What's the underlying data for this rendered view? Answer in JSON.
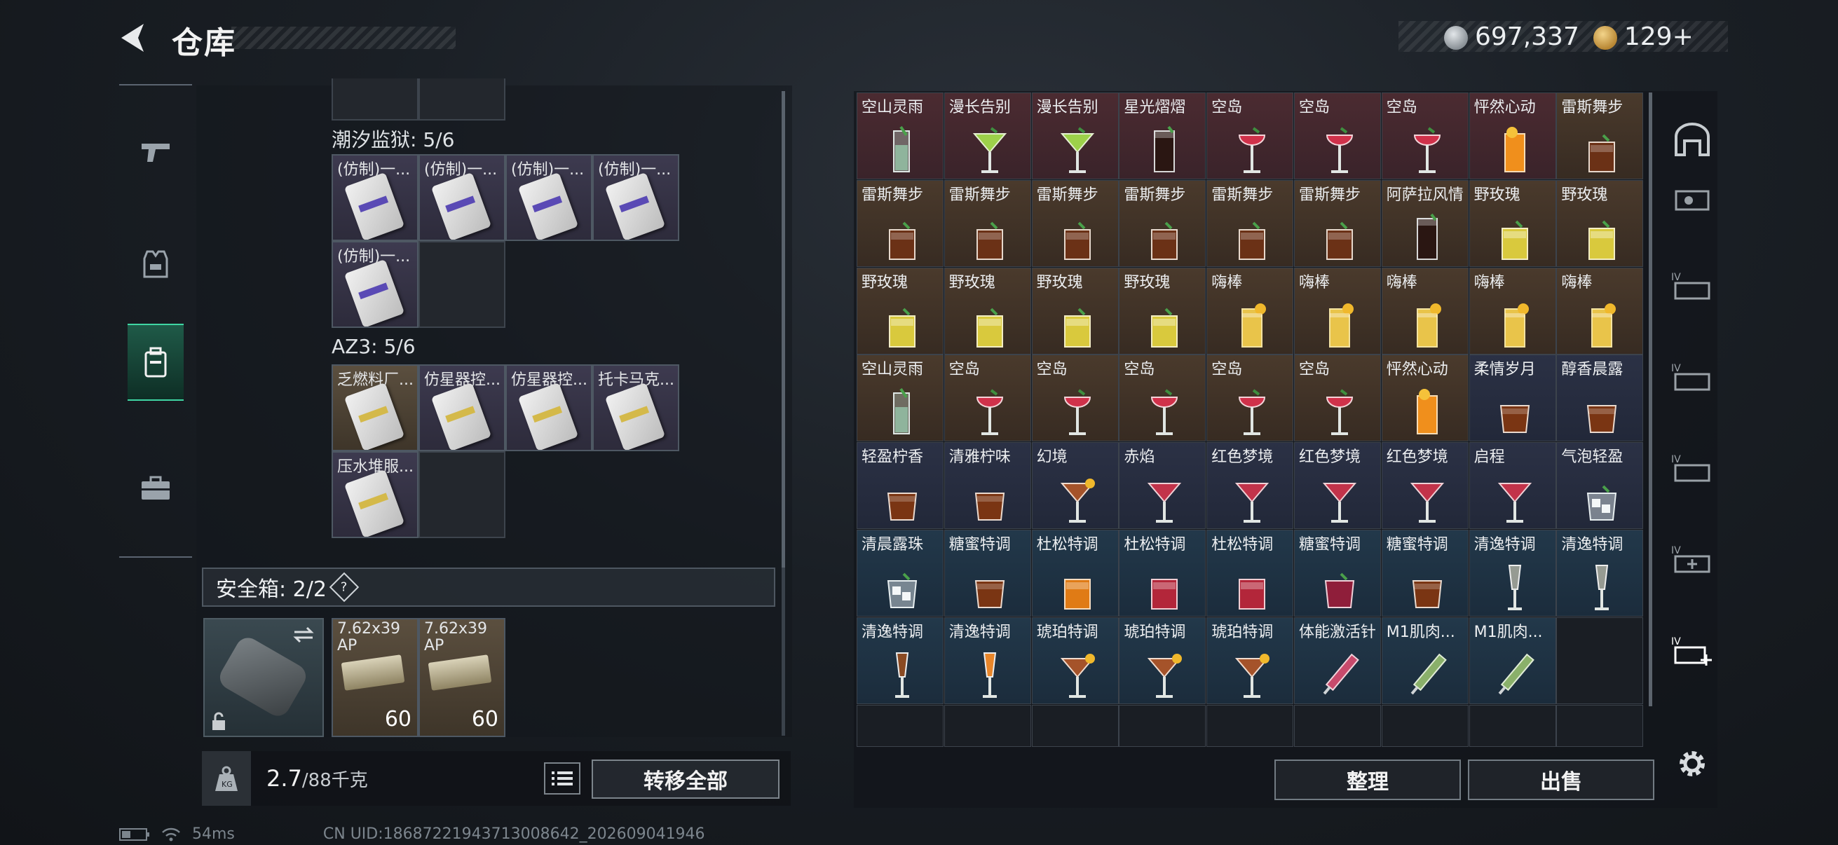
{
  "header": {
    "title": "仓库"
  },
  "currency": {
    "silver": "697,337",
    "gold": "129+"
  },
  "left": {
    "partial_row_label": "",
    "section1": {
      "label": "潮汐监狱: 5/6",
      "items": [
        "(仿制)一...",
        "(仿制)一...",
        "(仿制)一...",
        "(仿制)一...",
        "(仿制)一..."
      ]
    },
    "section2": {
      "label": "AZ3: 5/6",
      "items": [
        "乏燃料厂...",
        "仿星器控...",
        "仿星器控...",
        "托卡马克...",
        "压水堆服..."
      ]
    },
    "safe": {
      "label": "安全箱: 2/2",
      "help": "?"
    },
    "ammo": [
      {
        "name": "7.62x39 AP",
        "count": "60"
      },
      {
        "name": "7.62x39 AP",
        "count": "60"
      }
    ],
    "weight": {
      "value": "2.7",
      "cap": "/88千克"
    },
    "transfer_all": "转移全部"
  },
  "grid": {
    "rows": [
      [
        {
          "n": "空山灵雨",
          "bg": "red",
          "d": "highball"
        },
        {
          "n": "漫长告别",
          "bg": "red",
          "d": "martini-green"
        },
        {
          "n": "漫长告别",
          "bg": "red",
          "d": "martini-green"
        },
        {
          "n": "星光熠熠",
          "bg": "red",
          "d": "cola"
        },
        {
          "n": "空岛",
          "bg": "red",
          "d": "coupe-red"
        },
        {
          "n": "空岛",
          "bg": "red",
          "d": "coupe-red"
        },
        {
          "n": "空岛",
          "bg": "red",
          "d": "coupe-red"
        },
        {
          "n": "怦然心动",
          "bg": "red",
          "d": "orange-tall"
        },
        {
          "n": "雷斯舞步",
          "bg": "brown",
          "d": "rocks-brown"
        }
      ],
      [
        {
          "n": "雷斯舞步",
          "bg": "brown",
          "d": "rocks-brown"
        },
        {
          "n": "雷斯舞步",
          "bg": "brown",
          "d": "rocks-brown"
        },
        {
          "n": "雷斯舞步",
          "bg": "brown",
          "d": "rocks-brown"
        },
        {
          "n": "雷斯舞步",
          "bg": "brown",
          "d": "rocks-brown"
        },
        {
          "n": "雷斯舞步",
          "bg": "brown",
          "d": "rocks-brown"
        },
        {
          "n": "雷斯舞步",
          "bg": "brown",
          "d": "rocks-brown"
        },
        {
          "n": "阿萨拉风情",
          "bg": "brown",
          "d": "cola"
        },
        {
          "n": "野玫瑰",
          "bg": "brown",
          "d": "rocks-yellow"
        },
        {
          "n": "野玫瑰",
          "bg": "brown",
          "d": "rocks-yellow"
        }
      ],
      [
        {
          "n": "野玫瑰",
          "bg": "brown",
          "d": "rocks-yellow"
        },
        {
          "n": "野玫瑰",
          "bg": "brown",
          "d": "rocks-yellow"
        },
        {
          "n": "野玫瑰",
          "bg": "brown",
          "d": "rocks-yellow"
        },
        {
          "n": "野玫瑰",
          "bg": "brown",
          "d": "rocks-yellow"
        },
        {
          "n": "嗨棒",
          "bg": "brown",
          "d": "highball-yellow"
        },
        {
          "n": "嗨棒",
          "bg": "brown",
          "d": "highball-yellow"
        },
        {
          "n": "嗨棒",
          "bg": "brown",
          "d": "highball-yellow"
        },
        {
          "n": "嗨棒",
          "bg": "brown",
          "d": "highball-yellow"
        },
        {
          "n": "嗨棒",
          "bg": "brown",
          "d": "highball-yellow"
        }
      ],
      [
        {
          "n": "空山灵雨",
          "bg": "brown",
          "d": "highball"
        },
        {
          "n": "空岛",
          "bg": "brown",
          "d": "coupe-red"
        },
        {
          "n": "空岛",
          "bg": "brown",
          "d": "coupe-red"
        },
        {
          "n": "空岛",
          "bg": "brown",
          "d": "coupe-red"
        },
        {
          "n": "空岛",
          "bg": "brown",
          "d": "coupe-red"
        },
        {
          "n": "空岛",
          "bg": "brown",
          "d": "coupe-red"
        },
        {
          "n": "怦然心动",
          "bg": "brown",
          "d": "orange-tall"
        },
        {
          "n": "柔情岁月",
          "bg": "navy",
          "d": "round-brown"
        },
        {
          "n": "醇香晨露",
          "bg": "navy",
          "d": "round-brown"
        }
      ],
      [
        {
          "n": "轻盈柠香",
          "bg": "navy",
          "d": "round-brown"
        },
        {
          "n": "清雅柠味",
          "bg": "navy",
          "d": "round-brown"
        },
        {
          "n": "幻境",
          "bg": "navy",
          "d": "martini-brown"
        },
        {
          "n": "赤焰",
          "bg": "navy",
          "d": "martini-red"
        },
        {
          "n": "红色梦境",
          "bg": "navy",
          "d": "martini-red"
        },
        {
          "n": "红色梦境",
          "bg": "navy",
          "d": "martini-red"
        },
        {
          "n": "红色梦境",
          "bg": "navy",
          "d": "martini-red"
        },
        {
          "n": "启程",
          "bg": "navy",
          "d": "martini-red"
        },
        {
          "n": "气泡轻盈",
          "bg": "navy",
          "d": "ice"
        }
      ],
      [
        {
          "n": "清晨露珠",
          "bg": "teal",
          "d": "ice"
        },
        {
          "n": "糖蜜特调",
          "bg": "teal",
          "d": "round-brown"
        },
        {
          "n": "杜松特调",
          "bg": "teal",
          "d": "rocks-orange"
        },
        {
          "n": "杜松特调",
          "bg": "teal",
          "d": "rocks-red"
        },
        {
          "n": "杜松特调",
          "bg": "teal",
          "d": "rocks-red"
        },
        {
          "n": "糖蜜特调",
          "bg": "teal",
          "d": "round-red"
        },
        {
          "n": "糖蜜特调",
          "bg": "teal",
          "d": "round-brown"
        },
        {
          "n": "清逸特调",
          "bg": "teal",
          "d": "flute"
        },
        {
          "n": "清逸特调",
          "bg": "teal",
          "d": "flute"
        }
      ],
      [
        {
          "n": "清逸特调",
          "bg": "teal",
          "d": "flute-brown"
        },
        {
          "n": "清逸特调",
          "bg": "teal",
          "d": "flute-orange"
        },
        {
          "n": "琥珀特调",
          "bg": "teal",
          "d": "martini-brown"
        },
        {
          "n": "琥珀特调",
          "bg": "teal",
          "d": "martini-brown"
        },
        {
          "n": "琥珀特调",
          "bg": "teal",
          "d": "martini-brown"
        },
        {
          "n": "体能激活针",
          "bg": "teal",
          "d": "syringe-pink"
        },
        {
          "n": "M1肌肉...",
          "bg": "teal",
          "d": "syringe-green"
        },
        {
          "n": "M1肌肉...",
          "bg": "teal",
          "d": "syringe-green"
        },
        {
          "n": "",
          "bg": "empty",
          "d": ""
        }
      ]
    ]
  },
  "buttons": {
    "sort": "整理",
    "sell": "出售"
  },
  "status": {
    "ping": "54ms",
    "uid": "CN UID:18687221943713008642_202609041946"
  }
}
